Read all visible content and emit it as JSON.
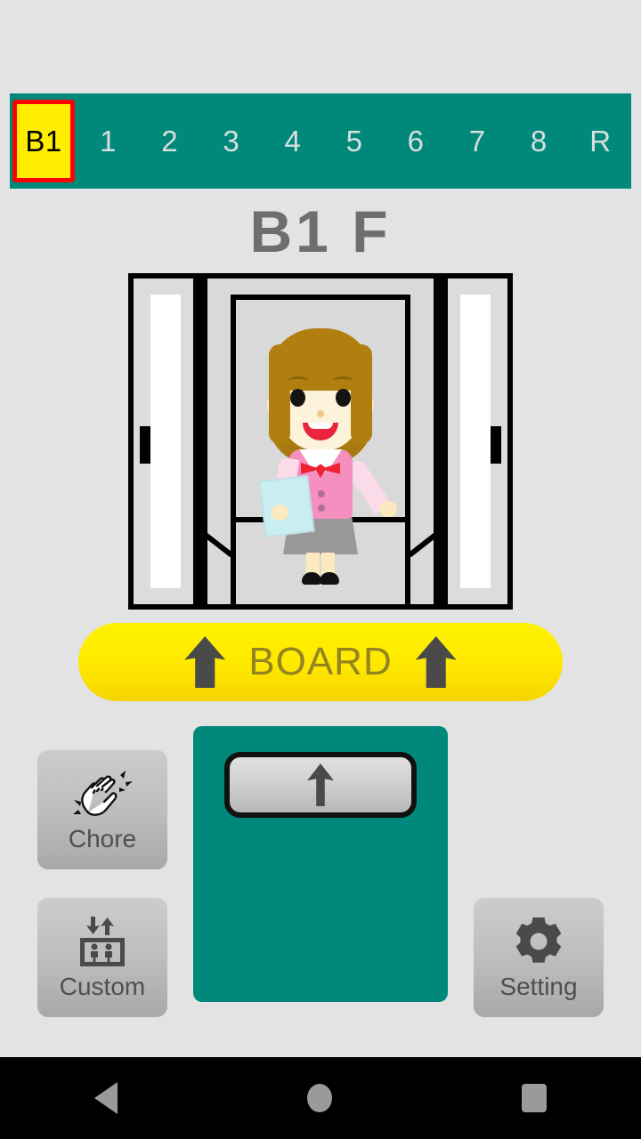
{
  "app": {
    "background_color": "#e3e3e3",
    "accent_teal": "#00897b",
    "highlight_yellow": "#ffee00",
    "highlight_border_red": "#ff0000"
  },
  "floor_selector": {
    "selected_floor": "B1",
    "items": [
      {
        "label": "B1",
        "selected": true
      },
      {
        "label": "1",
        "selected": false
      },
      {
        "label": "2",
        "selected": false
      },
      {
        "label": "3",
        "selected": false
      },
      {
        "label": "4",
        "selected": false
      },
      {
        "label": "5",
        "selected": false
      },
      {
        "label": "6",
        "selected": false
      },
      {
        "label": "7",
        "selected": false
      },
      {
        "label": "8",
        "selected": false
      },
      {
        "label": "R",
        "selected": false
      }
    ]
  },
  "current_floor_title": "B1 F",
  "elevator_scene": {
    "alt": "elevator-attendant-illustration",
    "doors_state": "open",
    "character": "elevator-attendant"
  },
  "board_button": {
    "label": "BOARD",
    "left_arrow_icon": "arrow-up-icon",
    "right_arrow_icon": "arrow-up-icon",
    "background_color": "#ffe800",
    "text_color": "#938420"
  },
  "direction_panel": {
    "direction_button_icon": "arrow-up-icon",
    "direction": "up"
  },
  "side_buttons": [
    {
      "label": "Chore",
      "icon": "clapping-hands-icon"
    },
    {
      "label": "Custom",
      "icon": "elevator-icon"
    },
    {
      "label": "Setting",
      "icon": "gear-icon"
    }
  ],
  "navbar": {
    "back_icon": "back-triangle-icon",
    "home_icon": "home-circle-icon",
    "recents_icon": "recents-square-icon"
  }
}
